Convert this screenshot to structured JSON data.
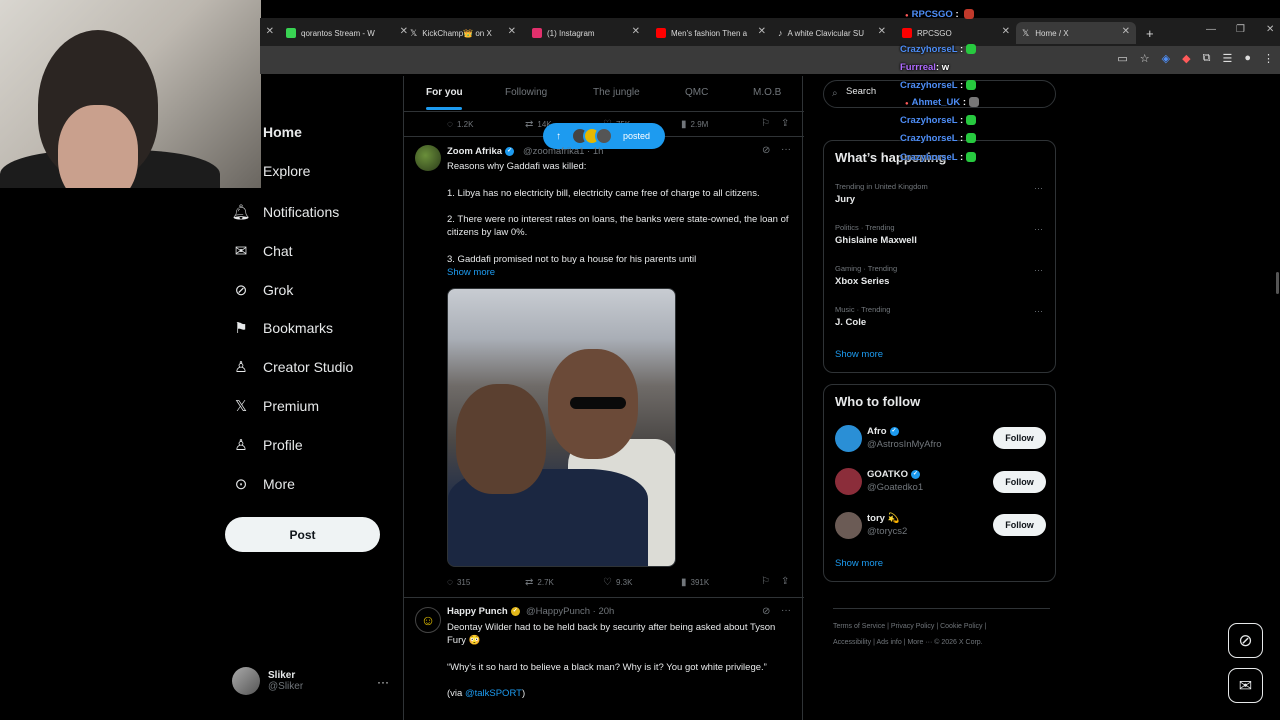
{
  "browser": {
    "tabs": [
      {
        "label": "qorantos Stream - W",
        "fav": "#39d353"
      },
      {
        "label": "KickChamp👑 on X",
        "fav": "#ffffff"
      },
      {
        "label": "(1) Instagram",
        "fav": "#e1306c"
      },
      {
        "label": "Men's fashion Then a",
        "fav": "#ff0000"
      },
      {
        "label": "A white Clavicular SU",
        "fav": "#ffffff"
      },
      {
        "label": "RPCSGO",
        "fav": "#ff0000"
      },
      {
        "label": "Home / X",
        "fav": "#ffffff"
      }
    ],
    "new_tab": "+"
  },
  "nav": {
    "home": "Home",
    "explore": "Explore",
    "notifications": "Notifications",
    "chat": "Chat",
    "grok": "Grok",
    "bookmarks": "Bookmarks",
    "creator_studio": "Creator Studio",
    "premium": "Premium",
    "profile": "Profile",
    "more": "More",
    "post": "Post",
    "user_name": "Sliker",
    "user_handle": "@Sliker",
    "more_dots": "···"
  },
  "feed_tabs": [
    "For you",
    "Following",
    "The jungle",
    "QMC",
    "M.O.B"
  ],
  "prev_actions": {
    "replies": "1.2K",
    "reposts": "14K",
    "likes": "75K",
    "views": "2.9M"
  },
  "posted_pill": {
    "label": "posted"
  },
  "tweet1": {
    "name": "Zoom Afrika",
    "handle": "@zoomafrika1 · 1h",
    "lines": [
      "Reasons why Gaddafi was killed:",
      "1. Libya has no electricity bill, electricity came free of charge to all citizens.",
      "2. There were no interest rates on loans, the banks were state-owned, the loan of citizens by law 0%.",
      "3. Gaddafi promised not to buy a house for his parents until"
    ],
    "show_more": "Show more",
    "replies": "315",
    "reposts": "2.7K",
    "likes": "9.3K",
    "views": "391K"
  },
  "tweet2": {
    "name": "Happy Punch",
    "handle": "@HappyPunch · 20h",
    "line1": "Deontay Wilder had to be held back by security after being asked about Tyson Fury 😳",
    "line2": "“Why’s it so hard to believe a black man? Why is it? You got white privilege.”",
    "line3_prefix": "(via ",
    "line3_link": "@talkSPORT",
    "line3_suffix": ")"
  },
  "search": {
    "placeholder": "Search"
  },
  "happening": {
    "title": "What’s happening",
    "trends": [
      {
        "category": "Trending in United Kingdom",
        "name": "Jury"
      },
      {
        "category": "Politics · Trending",
        "name": "Ghislaine Maxwell"
      },
      {
        "category": "Gaming · Trending",
        "name": "Xbox Series"
      },
      {
        "category": "Music · Trending",
        "name": "J. Cole"
      }
    ],
    "show_more": "Show more"
  },
  "who_to_follow": {
    "title": "Who to follow",
    "users": [
      {
        "name": "Afro",
        "handle": "@AstrosInMyAfro",
        "color": "#2a8fd6"
      },
      {
        "name": "GOATKO",
        "handle": "@Goatedko1",
        "color": "#8b2d3a"
      },
      {
        "name": "tory 💫",
        "handle": "@torycs2",
        "color": "#6b5b55"
      }
    ],
    "follow_label": "Follow",
    "show_more": "Show more"
  },
  "footer": {
    "line1": "Terms of Service  |  Privacy Policy  |  Cookie Policy  |",
    "line2": "Accessibility  |  Ads info  |  More ···  © 2026 X Corp."
  },
  "chat": [
    {
      "user": "RPCSGO",
      "msg": ":"
    },
    {
      "user": "CrazyhorseL",
      "msg": ":"
    },
    {
      "user": "Furrreal",
      "msg": ": w"
    },
    {
      "user": "CrazyhorseL",
      "msg": ":"
    },
    {
      "user": "Ahmet_UK",
      "msg": ":"
    },
    {
      "user": "CrazyhorseL",
      "msg": ":"
    },
    {
      "user": "CrazyhorseL",
      "msg": ":"
    },
    {
      "user": "CrazyhorseL",
      "msg": ":"
    }
  ]
}
